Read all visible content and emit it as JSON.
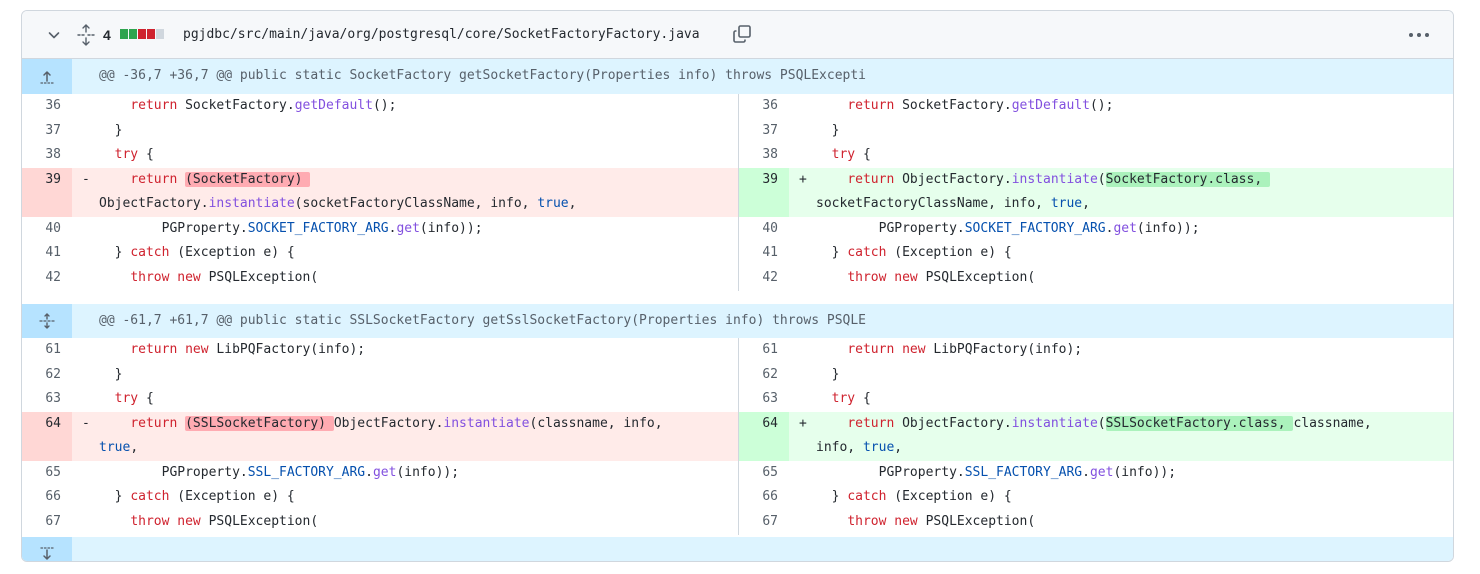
{
  "file": {
    "changes": "4",
    "path": "pgjdbc/src/main/java/org/postgresql/core/SocketFactoryFactory.java",
    "diffstat_colors": [
      "#2da44e",
      "#2da44e",
      "#cf222e",
      "#cf222e",
      "#d0d7de"
    ]
  },
  "hunks": [
    {
      "header": "@@ -36,7 +36,7 @@ public static SocketFactory getSocketFactory(Properties info) throws PSQLExcepti"
    },
    {
      "header": "@@ -61,7 +61,7 @@ public static SSLSocketFactory getSslSocketFactory(Properties info) throws PSQLE"
    }
  ],
  "rows": [
    {
      "l": "36",
      "r": "36",
      "lcode": [
        [
          "    "
        ],
        [
          "return",
          "kw"
        ],
        [
          " SocketFactory."
        ],
        [
          "getDefault",
          "fn"
        ],
        [
          "();"
        ]
      ],
      "rcode": [
        [
          "    "
        ],
        [
          "return",
          "kw"
        ],
        [
          " SocketFactory."
        ],
        [
          "getDefault",
          "fn"
        ],
        [
          "();"
        ]
      ]
    },
    {
      "l": "37",
      "r": "37",
      "lcode": [
        [
          "  }"
        ]
      ],
      "rcode": [
        [
          "  }"
        ]
      ]
    },
    {
      "l": "38",
      "r": "38",
      "lcode": [
        [
          "  "
        ],
        [
          "try",
          "kw"
        ],
        [
          " {"
        ]
      ],
      "rcode": [
        [
          "  "
        ],
        [
          "try",
          "kw"
        ],
        [
          " {"
        ]
      ]
    },
    {
      "l": "39",
      "r": "39",
      "lsign": "-",
      "rsign": "+",
      "lcode": [
        [
          "    "
        ],
        [
          "return",
          "kw"
        ],
        [
          " "
        ],
        [
          "(SocketFactory) ",
          "hl-del"
        ],
        [
          "\nObjectFactory."
        ],
        [
          "instantiate",
          "fn"
        ],
        [
          "(socketFactoryClassName, info, "
        ],
        [
          "true",
          "cn"
        ],
        [
          ","
        ]
      ],
      "rcode": [
        [
          "    "
        ],
        [
          "return",
          "kw"
        ],
        [
          " ObjectFactory."
        ],
        [
          "instantiate",
          "fn"
        ],
        [
          "("
        ],
        [
          "SocketFactory.class, ",
          "hl-add"
        ],
        [
          "\nsocketFactoryClassName, info, "
        ],
        [
          "true",
          "cn"
        ],
        [
          ","
        ]
      ]
    },
    {
      "l": "40",
      "r": "40",
      "lcode": [
        [
          "        PGProperty."
        ],
        [
          "SOCKET_FACTORY_ARG",
          "cn"
        ],
        [
          "."
        ],
        [
          "get",
          "fn"
        ],
        [
          "(info));"
        ]
      ],
      "rcode": [
        [
          "        PGProperty."
        ],
        [
          "SOCKET_FACTORY_ARG",
          "cn"
        ],
        [
          "."
        ],
        [
          "get",
          "fn"
        ],
        [
          "(info));"
        ]
      ]
    },
    {
      "l": "41",
      "r": "41",
      "lcode": [
        [
          "  } "
        ],
        [
          "catch",
          "kw"
        ],
        [
          " (Exception e) {"
        ]
      ],
      "rcode": [
        [
          "  } "
        ],
        [
          "catch",
          "kw"
        ],
        [
          " (Exception e) {"
        ]
      ]
    },
    {
      "l": "42",
      "r": "42",
      "lcode": [
        [
          "    "
        ],
        [
          "throw",
          "kw"
        ],
        [
          " "
        ],
        [
          "new",
          "kw"
        ],
        [
          " PSQLException("
        ]
      ],
      "rcode": [
        [
          "    "
        ],
        [
          "throw",
          "kw"
        ],
        [
          " "
        ],
        [
          "new",
          "kw"
        ],
        [
          " PSQLException("
        ]
      ]
    },
    {
      "l": "61",
      "r": "61",
      "lcode": [
        [
          "    "
        ],
        [
          "return",
          "kw"
        ],
        [
          " "
        ],
        [
          "new",
          "kw"
        ],
        [
          " LibPQFactory(info);"
        ]
      ],
      "rcode": [
        [
          "    "
        ],
        [
          "return",
          "kw"
        ],
        [
          " "
        ],
        [
          "new",
          "kw"
        ],
        [
          " LibPQFactory(info);"
        ]
      ]
    },
    {
      "l": "62",
      "r": "62",
      "lcode": [
        [
          "  }"
        ]
      ],
      "rcode": [
        [
          "  }"
        ]
      ]
    },
    {
      "l": "63",
      "r": "63",
      "lcode": [
        [
          "  "
        ],
        [
          "try",
          "kw"
        ],
        [
          " {"
        ]
      ],
      "rcode": [
        [
          "  "
        ],
        [
          "try",
          "kw"
        ],
        [
          " {"
        ]
      ]
    },
    {
      "l": "64",
      "r": "64",
      "lsign": "-",
      "rsign": "+",
      "lcode": [
        [
          "    "
        ],
        [
          "return",
          "kw"
        ],
        [
          " "
        ],
        [
          "(SSLSocketFactory) ",
          "hl-del"
        ],
        [
          "ObjectFactory."
        ],
        [
          "instantiate",
          "fn"
        ],
        [
          "(classname, info,\n"
        ],
        [
          "true",
          "cn"
        ],
        [
          ","
        ]
      ],
      "rcode": [
        [
          "    "
        ],
        [
          "return",
          "kw"
        ],
        [
          " ObjectFactory."
        ],
        [
          "instantiate",
          "fn"
        ],
        [
          "("
        ],
        [
          "SSLSocketFactory.class, ",
          "hl-add"
        ],
        [
          "classname,\ninfo, "
        ],
        [
          "true",
          "cn"
        ],
        [
          ","
        ]
      ]
    },
    {
      "l": "65",
      "r": "65",
      "lcode": [
        [
          "        PGProperty."
        ],
        [
          "SSL_FACTORY_ARG",
          "cn"
        ],
        [
          "."
        ],
        [
          "get",
          "fn"
        ],
        [
          "(info));"
        ]
      ],
      "rcode": [
        [
          "        PGProperty."
        ],
        [
          "SSL_FACTORY_ARG",
          "cn"
        ],
        [
          "."
        ],
        [
          "get",
          "fn"
        ],
        [
          "(info));"
        ]
      ]
    },
    {
      "l": "66",
      "r": "66",
      "lcode": [
        [
          "  } "
        ],
        [
          "catch",
          "kw"
        ],
        [
          " (Exception e) {"
        ]
      ],
      "rcode": [
        [
          "  } "
        ],
        [
          "catch",
          "kw"
        ],
        [
          " (Exception e) {"
        ]
      ]
    },
    {
      "l": "67",
      "r": "67",
      "lcode": [
        [
          "    "
        ],
        [
          "throw",
          "kw"
        ],
        [
          " "
        ],
        [
          "new",
          "kw"
        ],
        [
          " PSQLException("
        ]
      ],
      "rcode": [
        [
          "    "
        ],
        [
          "throw",
          "kw"
        ],
        [
          " "
        ],
        [
          "new",
          "kw"
        ],
        [
          " PSQLException("
        ]
      ]
    }
  ]
}
